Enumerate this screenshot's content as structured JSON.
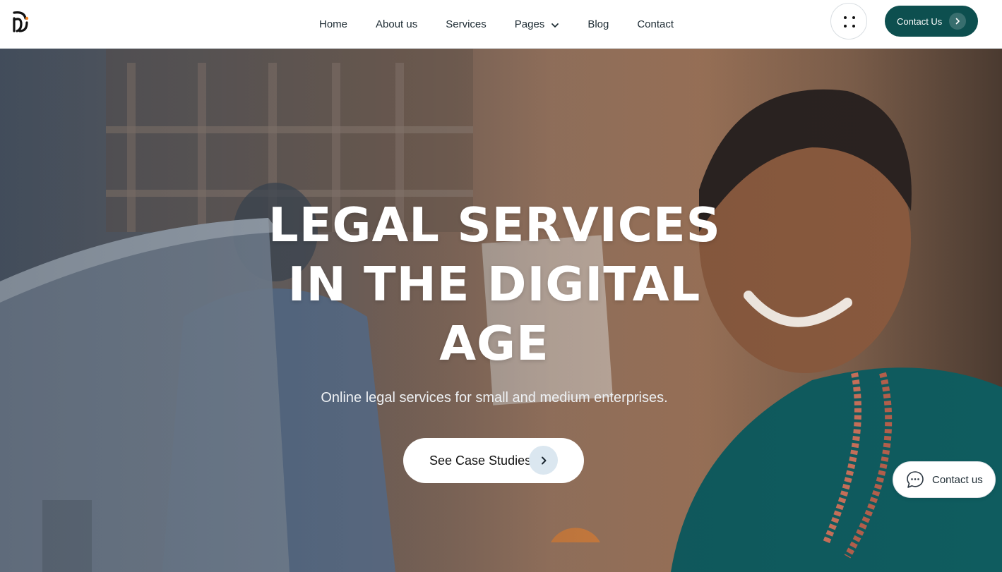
{
  "nav": {
    "logo_icon": "law-firm-logo-icon",
    "items": [
      {
        "label": "Home"
      },
      {
        "label": "About us"
      },
      {
        "label": "Services"
      },
      {
        "label": "Pages",
        "has_dropdown": true
      },
      {
        "label": "Blog"
      },
      {
        "label": "Contact"
      }
    ],
    "grid_icon": "dots-grid-icon",
    "cta_label": "Contact Us",
    "cta_icon": "chevron-right-icon"
  },
  "hero": {
    "headline_line1": "LEGAL SERVICES",
    "headline_line2": "IN THE DIGITAL",
    "headline_line3": "AGE",
    "subtitle": "Online legal services for small and medium enterprises.",
    "button_label": "See Case Studies",
    "button_icon": "chevron-right-icon"
  },
  "chat": {
    "label": "Contact us",
    "icon": "chat-bubble-icon"
  },
  "colors": {
    "brand": "#0d4f4f",
    "text": "#1d2b33",
    "accent": "#f58220"
  }
}
